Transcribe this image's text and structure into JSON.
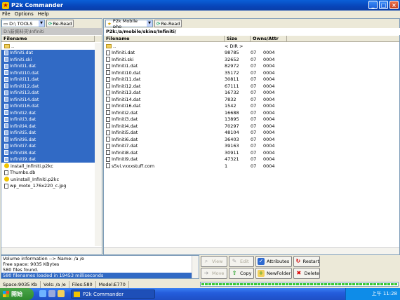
{
  "window": {
    "title": "P2k Commander"
  },
  "menu": [
    "File",
    "Options",
    "Help"
  ],
  "left": {
    "drive": "D:\\ TOOLS",
    "reread": "Re-Read",
    "path": "D:\\新資料夾\\Infiniti",
    "header": "Filename",
    "files": [
      {
        "name": "..",
        "type": "folder",
        "selected": false
      },
      {
        "name": "Infiniti.dat",
        "type": "file",
        "selected": true
      },
      {
        "name": "Infiniti.ski",
        "type": "file",
        "selected": true
      },
      {
        "name": "Infiniti1.dat",
        "type": "file",
        "selected": true
      },
      {
        "name": "Infiniti10.dat",
        "type": "file",
        "selected": true
      },
      {
        "name": "Infiniti11.dat",
        "type": "file",
        "selected": true
      },
      {
        "name": "Infiniti12.dat",
        "type": "file",
        "selected": true
      },
      {
        "name": "Infiniti13.dat",
        "type": "file",
        "selected": true
      },
      {
        "name": "Infiniti14.dat",
        "type": "file",
        "selected": true
      },
      {
        "name": "Infiniti16.dat",
        "type": "file",
        "selected": true
      },
      {
        "name": "Infiniti2.dat",
        "type": "file",
        "selected": true
      },
      {
        "name": "Infiniti3.dat",
        "type": "file",
        "selected": true
      },
      {
        "name": "Infiniti4.dat",
        "type": "file",
        "selected": true
      },
      {
        "name": "Infiniti5.dat",
        "type": "file",
        "selected": true
      },
      {
        "name": "Infiniti6.dat",
        "type": "file",
        "selected": true
      },
      {
        "name": "Infiniti7.dat",
        "type": "file",
        "selected": true
      },
      {
        "name": "Infiniti8.dat",
        "type": "file",
        "selected": true
      },
      {
        "name": "Infiniti9.dat",
        "type": "file",
        "selected": true
      },
      {
        "name": "install_Infiniti.p2kc",
        "type": "script",
        "selected": false
      },
      {
        "name": "Thumbs.db",
        "type": "file",
        "selected": false
      },
      {
        "name": "uninstall_Infiniti.p2kc",
        "type": "script",
        "selected": false
      },
      {
        "name": "wp_moto_176x220_c.jpg",
        "type": "file",
        "selected": false
      }
    ]
  },
  "right": {
    "drive": "P2k Mobile pho",
    "reread": "Re-Read",
    "path": "P2k:/a/mobile/skins/Infiniti/",
    "headers": [
      "Filename",
      "Size",
      "Owns/Attr"
    ],
    "files": [
      {
        "name": "..",
        "size": "< DIR >",
        "owns": "",
        "attr": "",
        "type": "folder"
      },
      {
        "name": "Infiniti.dat",
        "size": "98785",
        "owns": "07",
        "attr": "0004",
        "type": "file"
      },
      {
        "name": "Infiniti.ski",
        "size": "32652",
        "owns": "07",
        "attr": "0004",
        "type": "file"
      },
      {
        "name": "Infiniti1.dat",
        "size": "82972",
        "owns": "07",
        "attr": "0004",
        "type": "file"
      },
      {
        "name": "Infiniti10.dat",
        "size": "35172",
        "owns": "07",
        "attr": "0004",
        "type": "file"
      },
      {
        "name": "Infiniti11.dat",
        "size": "30811",
        "owns": "07",
        "attr": "0004",
        "type": "file"
      },
      {
        "name": "Infiniti12.dat",
        "size": "67111",
        "owns": "07",
        "attr": "0004",
        "type": "file"
      },
      {
        "name": "Infiniti13.dat",
        "size": "16732",
        "owns": "07",
        "attr": "0004",
        "type": "file"
      },
      {
        "name": "Infiniti14.dat",
        "size": "7832",
        "owns": "07",
        "attr": "0004",
        "type": "file"
      },
      {
        "name": "Infiniti16.dat",
        "size": "1542",
        "owns": "07",
        "attr": "0004",
        "type": "file"
      },
      {
        "name": "Infiniti2.dat",
        "size": "16688",
        "owns": "07",
        "attr": "0004",
        "type": "file"
      },
      {
        "name": "Infiniti3.dat",
        "size": "13895",
        "owns": "07",
        "attr": "0004",
        "type": "file"
      },
      {
        "name": "Infiniti4.dat",
        "size": "70297",
        "owns": "07",
        "attr": "0004",
        "type": "file"
      },
      {
        "name": "Infiniti5.dat",
        "size": "48104",
        "owns": "07",
        "attr": "0004",
        "type": "file"
      },
      {
        "name": "Infiniti6.dat",
        "size": "36403",
        "owns": "07",
        "attr": "0004",
        "type": "file"
      },
      {
        "name": "Infiniti7.dat",
        "size": "39163",
        "owns": "07",
        "attr": "0004",
        "type": "file"
      },
      {
        "name": "Infiniti8.dat",
        "size": "30911",
        "owns": "07",
        "attr": "0004",
        "type": "file"
      },
      {
        "name": "Infiniti9.dat",
        "size": "47321",
        "owns": "07",
        "attr": "0004",
        "type": "file"
      },
      {
        "name": "s5vi.vxxxstuff.com",
        "size": "1",
        "owns": "07",
        "attr": "0004",
        "type": "file"
      }
    ]
  },
  "info": {
    "lines": [
      "Volume information -->  Name: /a /e",
      "Free space: 9035 KBytes",
      "580 files found."
    ],
    "highlight": "580 filenames loaded in 19453 milliseconds"
  },
  "actions": {
    "view": "View",
    "edit": "Edit",
    "attributes": "Attributes",
    "restart": "Restart",
    "move": "Move",
    "copy": "Copy",
    "newfolder": "NewFolder",
    "delete": "Delete"
  },
  "status": {
    "space": "Space:9035 Kb",
    "vols": "Vols: /a /e",
    "files": "Files:580",
    "model": "Model:E770",
    "progress": 1.0
  },
  "taskbar": {
    "start": "開始",
    "item": "P2k Commander",
    "clock": "上午 11:28"
  },
  "colors": {
    "selection": "#316ac5",
    "titlebar": "#0845b8",
    "progress": "#37c837"
  }
}
